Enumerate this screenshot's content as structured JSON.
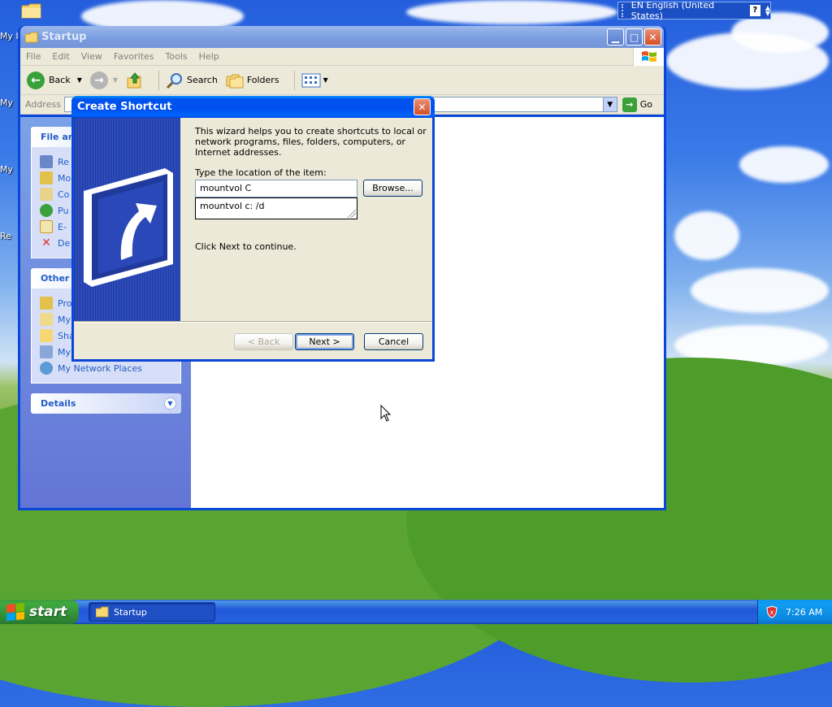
{
  "desktop": {
    "icon_labels": [
      "My I",
      "My",
      "My",
      "Re"
    ]
  },
  "language_bar": {
    "language": "EN English (United States)",
    "help": "?"
  },
  "explorer": {
    "title": "Startup",
    "menu": [
      "File",
      "Edit",
      "View",
      "Favorites",
      "Tools",
      "Help"
    ],
    "toolbar": {
      "back": "Back",
      "search": "Search",
      "folders": "Folders"
    },
    "address": {
      "label": "Address",
      "go": "Go"
    },
    "panels": {
      "file_tasks": {
        "title": "File an",
        "items": [
          "Re",
          "Mo",
          "Co",
          "Pu",
          "E-",
          "De"
        ]
      },
      "other_places": {
        "title": "Other",
        "items": [
          "Pro",
          "My",
          "Sha",
          "My",
          "My Network Places"
        ]
      },
      "details": {
        "title": "Details"
      }
    }
  },
  "dialog": {
    "title": "Create Shortcut",
    "intro": "This wizard helps you to create shortcuts to local or network programs, files, folders, computers, or Internet addresses.",
    "location_label": "Type the location of the item:",
    "location_value": "mountvol C",
    "suggestion": "mountvol c: /d",
    "hint": "Click Next to continue.",
    "buttons": {
      "browse": "Browse...",
      "back": "< Back",
      "next": "Next >",
      "cancel": "Cancel"
    }
  },
  "taskbar": {
    "start": "start",
    "task": "Startup",
    "clock": "7:26 AM"
  },
  "colors": {
    "xp_blue": "#0a46d8",
    "task_pane_link": "#215dc6",
    "start_green": "#3fa93f"
  }
}
